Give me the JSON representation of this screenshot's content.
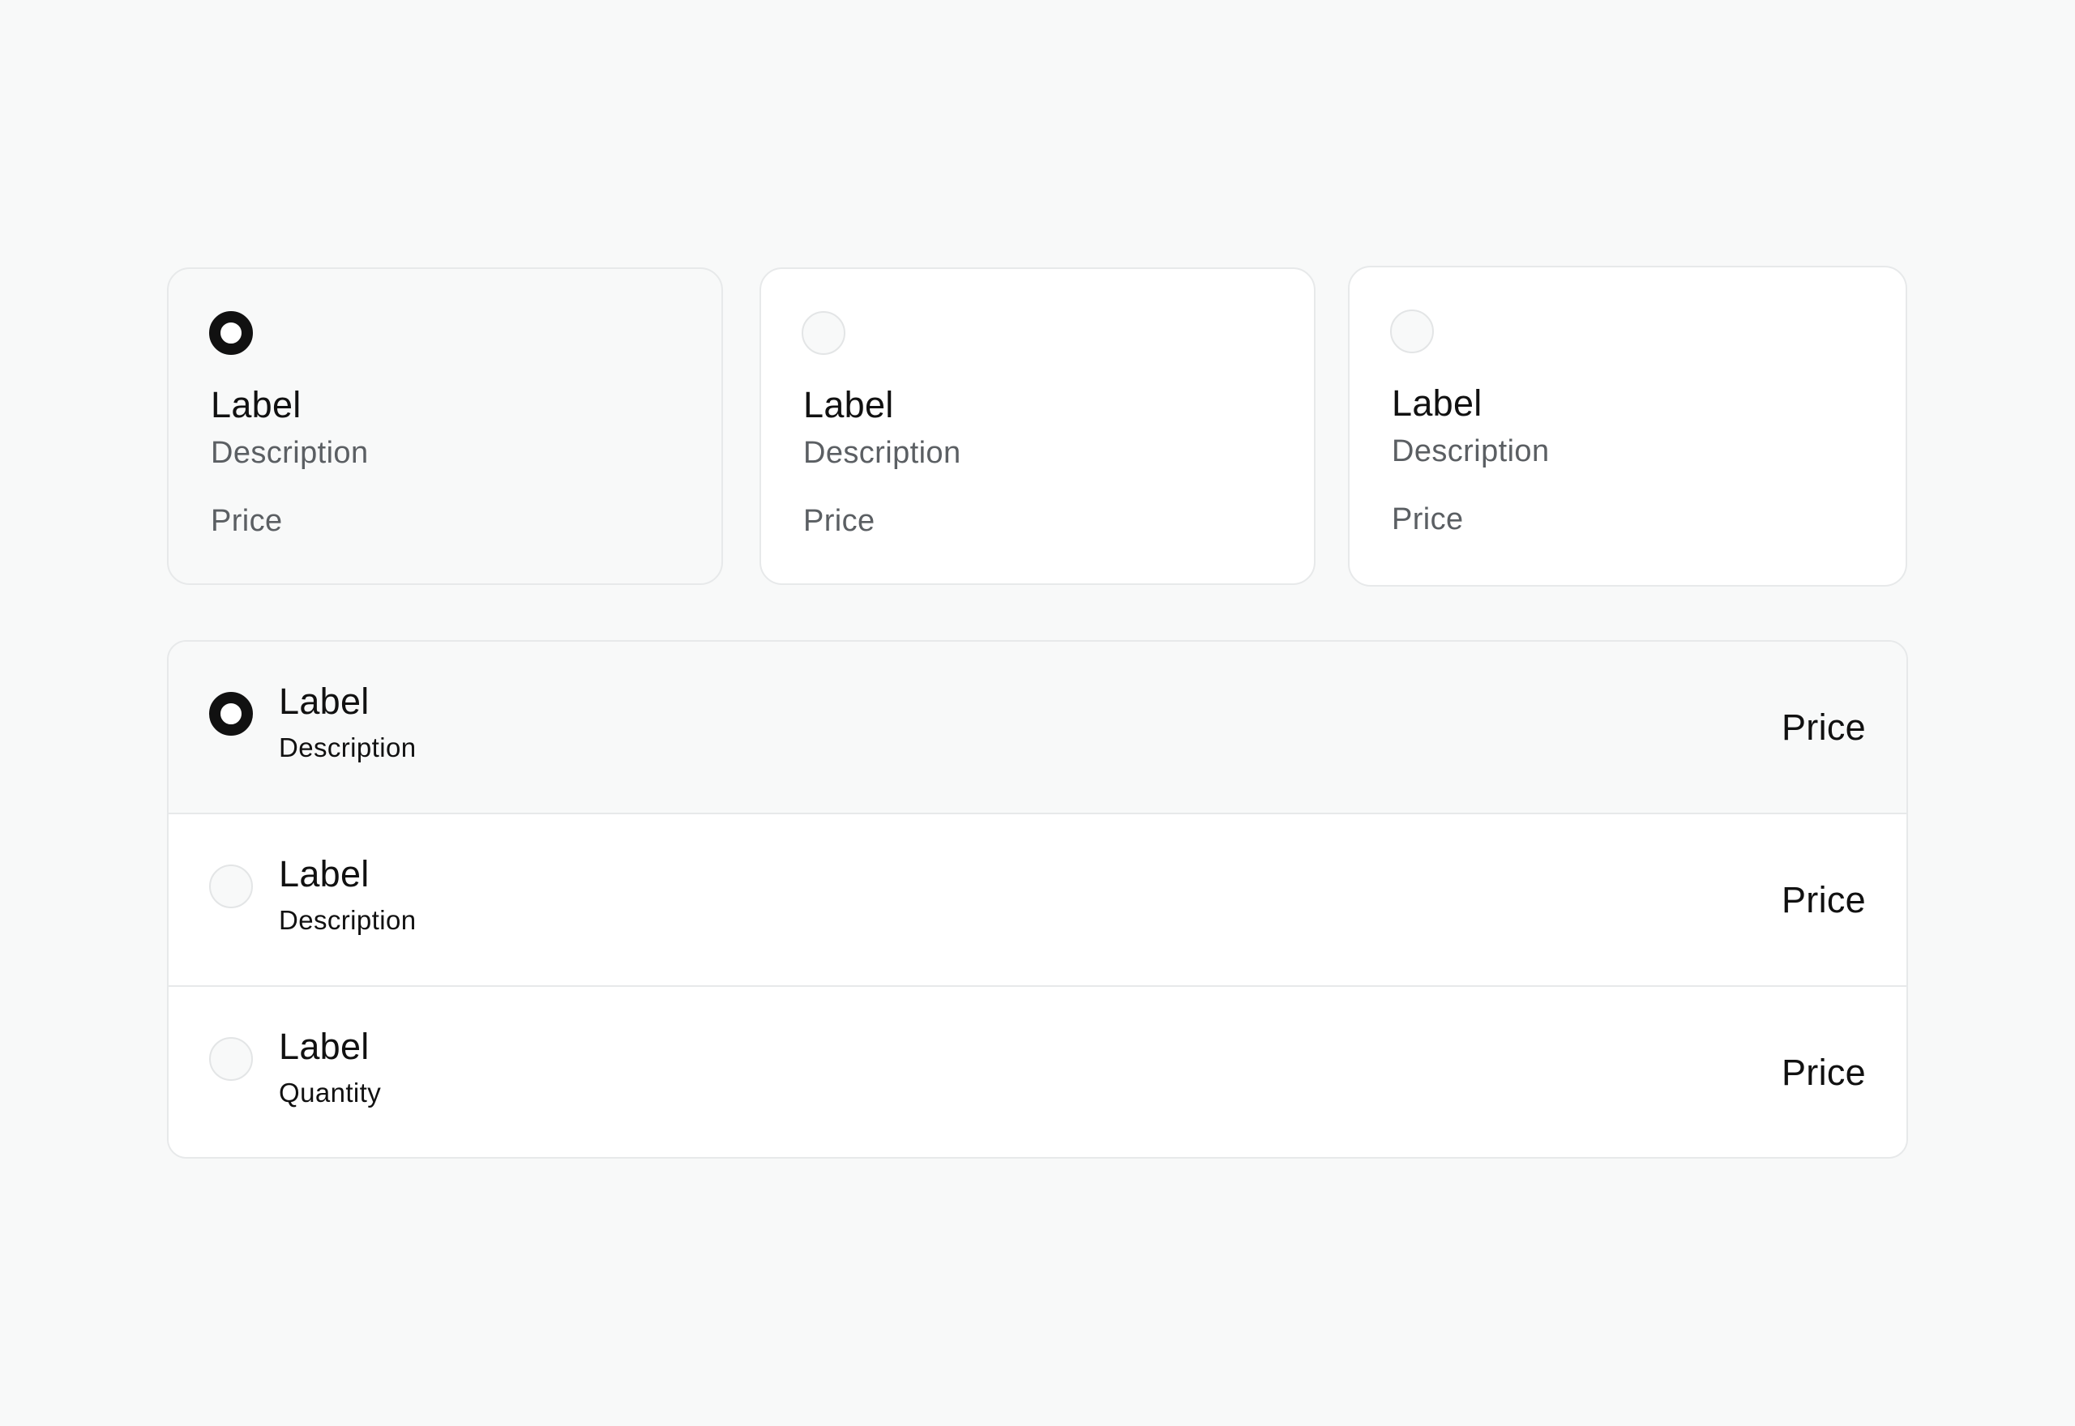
{
  "cards": [
    {
      "label": "Label",
      "description": "Description",
      "price": "Price",
      "selected": true
    },
    {
      "label": "Label",
      "description": "Description",
      "price": "Price",
      "selected": false
    },
    {
      "label": "Label",
      "description": "Description",
      "price": "Price",
      "selected": false
    }
  ],
  "list": [
    {
      "label": "Label",
      "description": "Description",
      "price": "Price",
      "selected": true
    },
    {
      "label": "Label",
      "description": "Description",
      "price": "Price",
      "selected": false
    },
    {
      "label": "Label",
      "description": "Quantity",
      "price": "Price",
      "selected": false
    }
  ],
  "colors": {
    "background": "#f8f9f9",
    "surface": "#ffffff",
    "border": "#e7e9ea",
    "text_primary": "#111111",
    "text_secondary": "#5b5f63",
    "radio_checked": "#111111"
  }
}
